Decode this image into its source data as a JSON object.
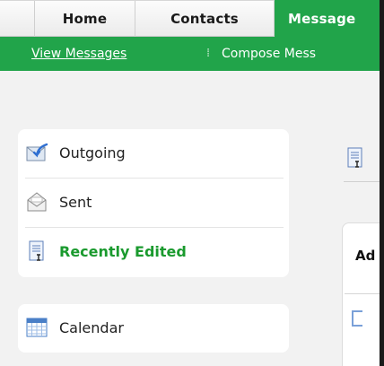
{
  "tabs": {
    "home": "Home",
    "contacts": "Contacts",
    "messages": "Message"
  },
  "subnav": {
    "view_messages": "View Messages",
    "separator": "⁞",
    "compose": "Compose Mess"
  },
  "nav": {
    "items": [
      {
        "label": "Outgoing",
        "icon": "outgoing-icon"
      },
      {
        "label": "Sent",
        "icon": "envelope-icon"
      },
      {
        "label": "Recently Edited",
        "icon": "document-icon",
        "active": true
      }
    ],
    "calendar": {
      "label": "Calendar",
      "icon": "calendar-icon"
    }
  },
  "content": {
    "box_heading": "Ad"
  },
  "colors": {
    "accent_green": "#21a44a",
    "active_label": "#1a9a2e"
  }
}
